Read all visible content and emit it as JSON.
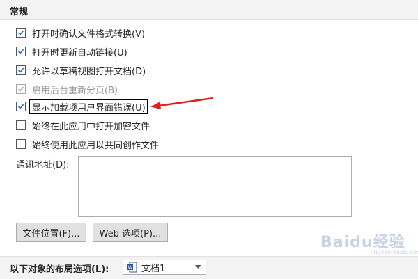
{
  "section": {
    "title": "常规"
  },
  "options": [
    {
      "label": "打开时确认文件格式转换(V)",
      "checked": true,
      "disabled": false
    },
    {
      "label": "打开时更新自动链接(U)",
      "checked": true,
      "disabled": false
    },
    {
      "label": "允许以草稿视图打开文档(D)",
      "checked": true,
      "disabled": false
    },
    {
      "label": "启用后台重新分页(B)",
      "checked": true,
      "disabled": true
    },
    {
      "label": "显示加载项用户界面错误(U)",
      "checked": true,
      "disabled": false
    },
    {
      "label": "始终在此应用中打开加密文件",
      "checked": false,
      "disabled": false
    },
    {
      "label": "始终使用此应用以共同创作文件",
      "checked": false,
      "disabled": false
    }
  ],
  "address": {
    "label": "通讯地址(D):",
    "value": ""
  },
  "buttons": {
    "file_locations": "文件位置(F)...",
    "web_options": "Web 选项(P)..."
  },
  "layout_options": {
    "label": "以下对象的布局选项(L):",
    "selected": "文档1"
  },
  "watermark": {
    "text": "Baidu经验",
    "sub": "jingyan.baidu.com"
  },
  "colors": {
    "annotation_arrow": "#e02020",
    "check": "#1e6fd9"
  }
}
